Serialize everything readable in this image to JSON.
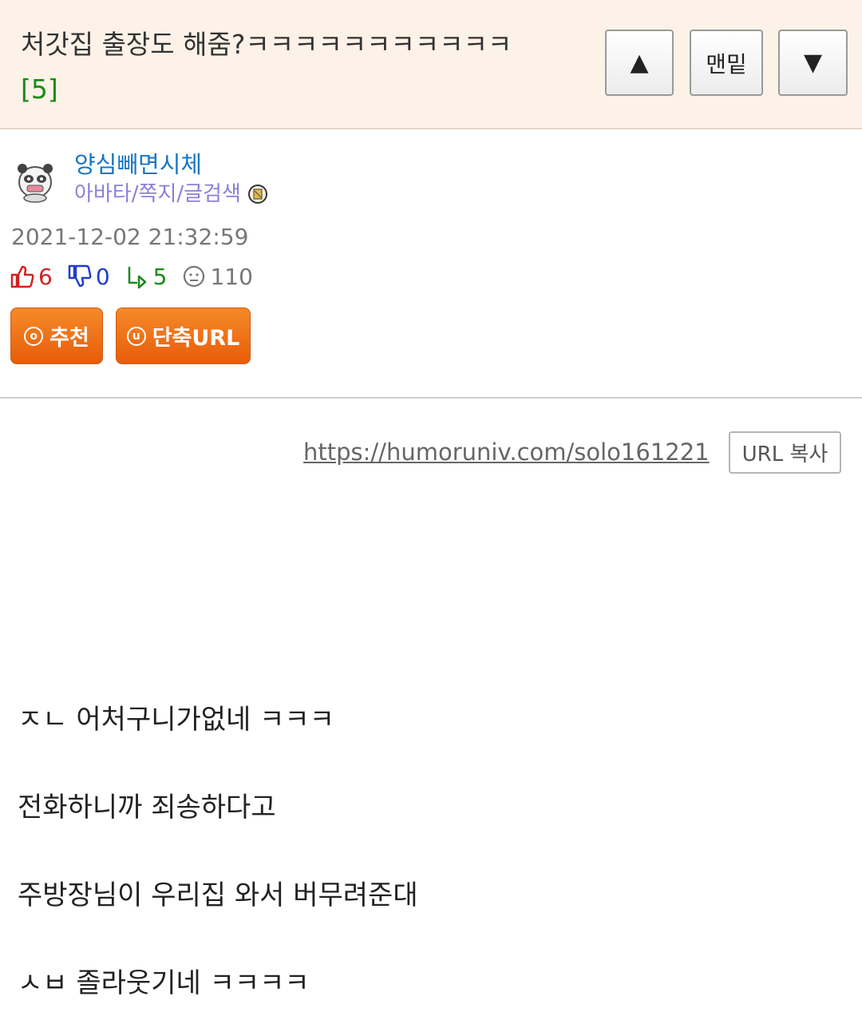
{
  "header": {
    "title": "처갓집 출장도 해줌?ㅋㅋㅋㅋㅋㅋㅋㅋㅋㅋㅋ",
    "comment_count": "[5]",
    "btn_up": "▲",
    "btn_bottom": "맨밑",
    "btn_down": "▼"
  },
  "author": {
    "nickname": "양심빼면시체",
    "links": "아바타/쪽지/글검색",
    "date": "2021-12-02 21:32:59"
  },
  "stats": {
    "recommend": "6",
    "not_recommend": "0",
    "share": "5",
    "views": "110"
  },
  "actions": {
    "recommend_label": "추천",
    "recommend_icon": "o",
    "shorturl_label": "단축URL",
    "shorturl_icon": "u"
  },
  "url_bar": {
    "url": "https://humoruniv.com/solo161221",
    "copy_label": "URL 복사"
  },
  "content": {
    "lines": [
      "ㅈㄴ 어처구니가없네 ㅋㅋㅋ",
      "전화하니까 죄송하다고",
      "주방장님이 우리집 와서 버무려준대",
      "ㅅㅂ 졸라웃기네 ㅋㅋㅋㅋ"
    ]
  },
  "colors": {
    "header_bg": "#fcf2e7",
    "nickname": "#1a75c2",
    "links": "#8a80d8",
    "button_orange": "#e85c0a",
    "recommend": "#d32020",
    "not_recommend": "#1f3fc9",
    "share": "#1a8a1a"
  }
}
